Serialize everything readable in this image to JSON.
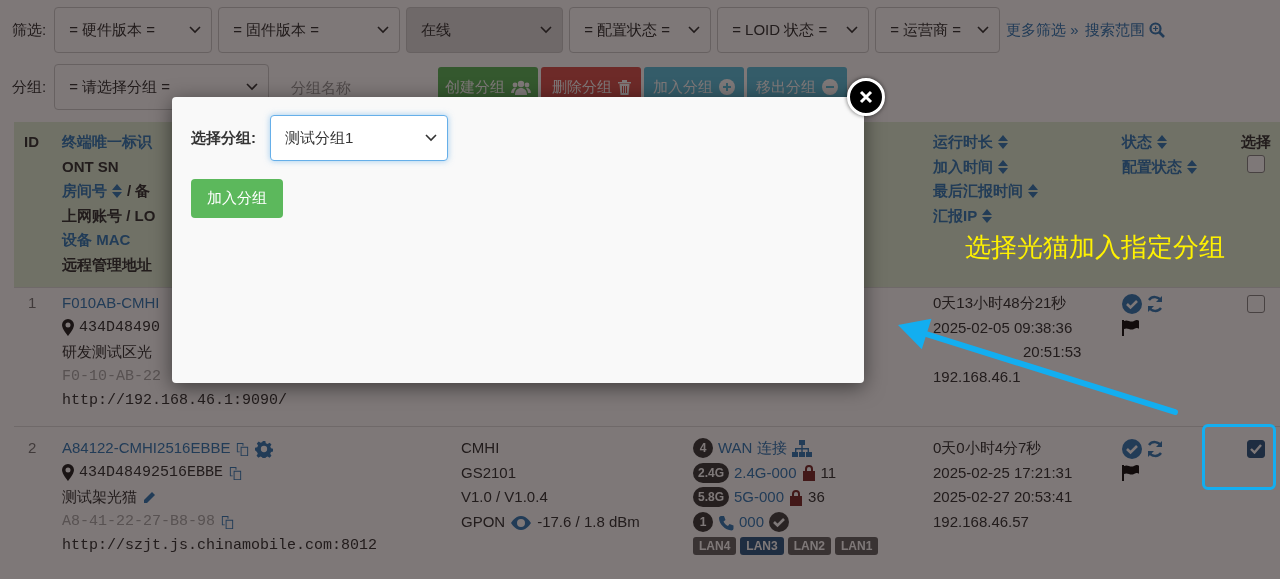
{
  "filters": {
    "label": "筛选:",
    "selects": [
      {
        "value": "= 硬件版本 =",
        "active": false
      },
      {
        "value": "= 固件版本 =",
        "active": false
      },
      {
        "value": "在线",
        "active": true
      },
      {
        "value": "= 配置状态 =",
        "active": false
      },
      {
        "value": "= LOID 状态 =",
        "active": false
      },
      {
        "value": "= 运营商 =",
        "active": false
      }
    ],
    "links": [
      {
        "text": "更多筛选 »",
        "kind": "more"
      },
      {
        "text": "搜索范围",
        "kind": "search"
      }
    ]
  },
  "group_bar": {
    "label": "分组:",
    "select": "= 请选择分组 =",
    "name_field": {
      "placeholder": "分组名称"
    },
    "buttons": [
      {
        "label": "创建分组",
        "kind": "create"
      },
      {
        "label": "删除分组",
        "kind": "delete"
      },
      {
        "label": "加入分组",
        "kind": "add"
      },
      {
        "label": "移出分组",
        "kind": "remove"
      }
    ]
  },
  "table": {
    "header": {
      "id": "ID",
      "identity": [
        {
          "text": "终端唯一标识",
          "link": true,
          "sortable": false
        },
        {
          "text": "ONT SN",
          "link": false,
          "sortable": false
        },
        {
          "text": "房间号",
          "link": true,
          "sortable": true,
          "rest": "/ 备"
        },
        {
          "text": "上网账号 / LO",
          "link": false,
          "sortable": false
        },
        {
          "text": "设备 MAC",
          "link": true,
          "sortable": false
        },
        {
          "text": "远程管理地址",
          "link": false,
          "sortable": false
        }
      ],
      "times": [
        {
          "text": "运行时长",
          "sortable": true
        },
        {
          "text": "加入时间",
          "sortable": true
        },
        {
          "text": "最后汇报时间",
          "sortable": true
        },
        {
          "text": "汇报IP",
          "sortable": true
        }
      ],
      "status": [
        {
          "text": "状态",
          "sortable": true
        },
        {
          "text": "配置状态",
          "sortable": true
        }
      ],
      "select": {
        "text": "选择",
        "checked": false
      }
    },
    "rows": [
      {
        "id": "1",
        "selected": false,
        "uid": {
          "text": "F010AB-CMHI",
          "tools": false
        },
        "sn": {
          "text": "434D48490",
          "copy": false
        },
        "note": {
          "text": "研发测试区光",
          "editable": false
        },
        "mac": {
          "text": "F0-10-AB-22",
          "copy": false
        },
        "url": "http://192.168.46.1:9090/",
        "times": [
          {
            "text": "0天13小时48分21秒",
            "cut": false
          },
          {
            "text": "2025-02-05 09:38:36",
            "cut": false
          },
          {
            "text": "20:51:53",
            "cut": true
          },
          {
            "text": "192.168.46.1",
            "cut": false
          }
        ]
      },
      {
        "id": "2",
        "selected": true,
        "uid": {
          "text": "A84122-CMHI2516EBBE",
          "tools": true
        },
        "sn": {
          "text": "434D48492516EBBE",
          "copy": true
        },
        "note": {
          "text": "测试架光猫",
          "editable": true
        },
        "mac": {
          "text": "A8-41-22-27-B8-98",
          "copy": true
        },
        "url": "http://szjt.js.chinamobile.com:8012",
        "device": {
          "vendor": "CMHI",
          "model": "GS2101",
          "versions": "V1.0 / V1.0.4",
          "pon": "GPON",
          "optical": "-17.6 / 1.8 dBm"
        },
        "network": {
          "wan_count": "4",
          "wan": "WAN 连接",
          "wifi": [
            {
              "band": "2.4G",
              "ssid": "2.4G-000",
              "locked": true,
              "clients": "11"
            },
            {
              "band": "5.8G",
              "ssid": "5G-000",
              "locked": true,
              "clients": "36"
            }
          ],
          "voice": {
            "count": "1",
            "number": "000"
          },
          "lan": [
            {
              "label": "LAN4",
              "on": false
            },
            {
              "label": "LAN3",
              "on": true
            },
            {
              "label": "LAN2",
              "on": false
            },
            {
              "label": "LAN1",
              "on": false
            }
          ]
        },
        "times": [
          {
            "text": "0天0小时4分7秒",
            "cut": false
          },
          {
            "text": "2025-02-25 17:21:31",
            "cut": false
          },
          {
            "text": "2025-02-27 20:53:41",
            "cut": false
          },
          {
            "text": "192.168.46.57",
            "cut": false
          }
        ]
      }
    ]
  },
  "modal": {
    "label": "选择分组:",
    "select": "测试分组1",
    "button": "加入分组"
  },
  "annotation": {
    "caption": "选择光猫加入指定分组"
  }
}
